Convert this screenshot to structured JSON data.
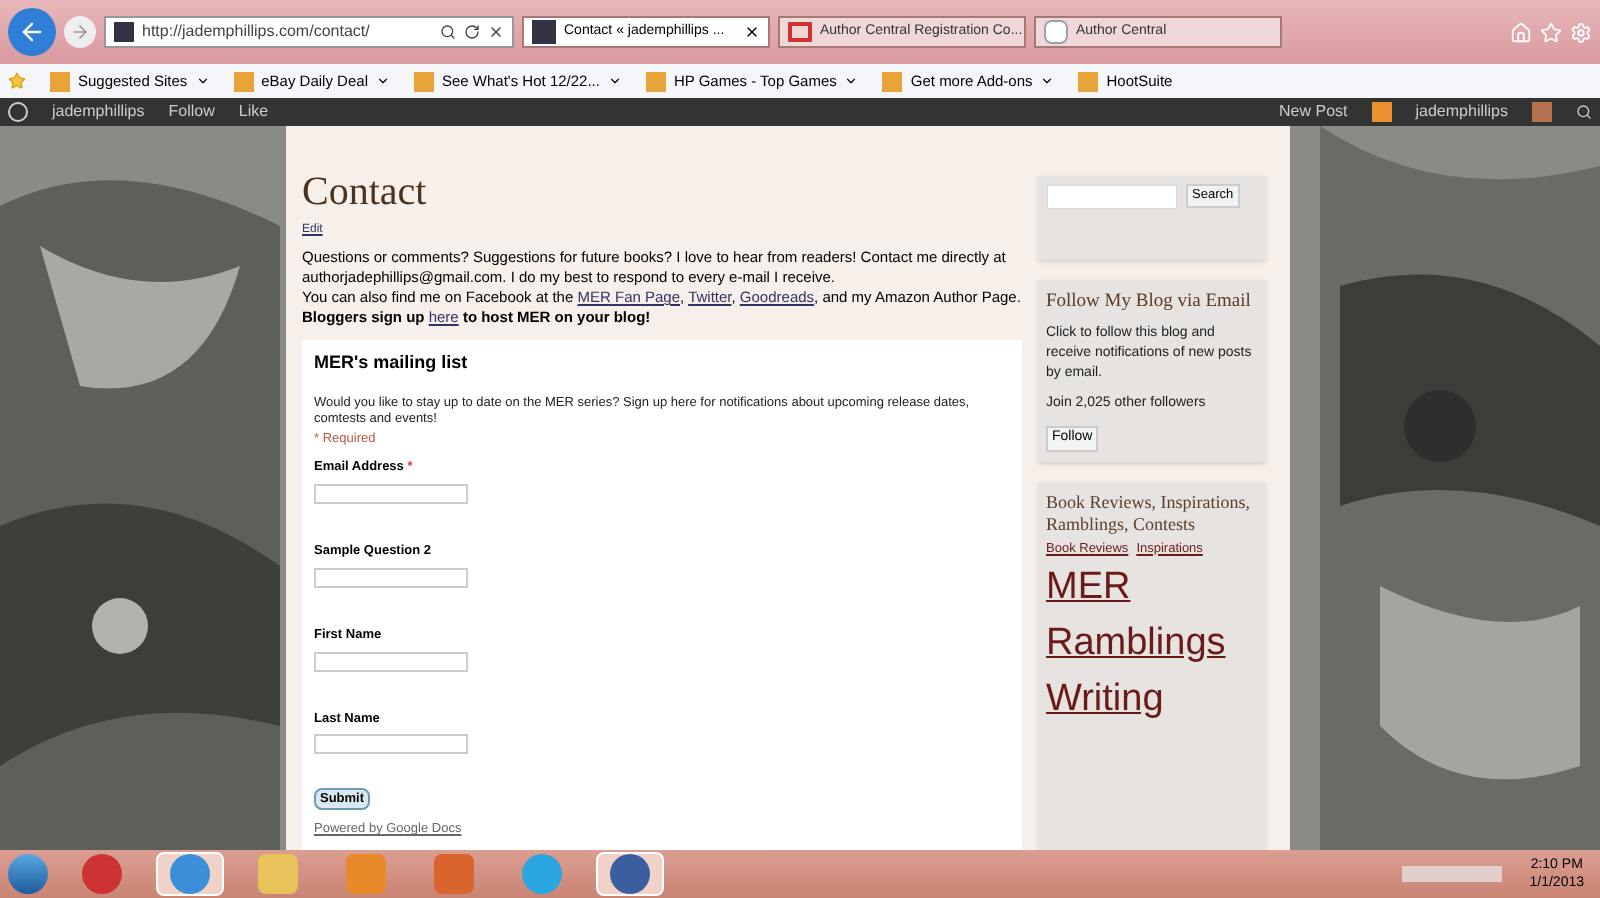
{
  "browser": {
    "address": "http://jademphillips.com/contact/",
    "tabs": [
      {
        "title": "Contact « jademphillips ...",
        "selected": true
      },
      {
        "title": "Author Central Registration Co...",
        "selected": false
      },
      {
        "title": "Author Central",
        "selected": false
      }
    ],
    "favorites": [
      {
        "label": "Suggested Sites",
        "menu": true
      },
      {
        "label": "eBay Daily Deal",
        "menu": true
      },
      {
        "label": "See What's Hot 12/22...",
        "menu": true
      },
      {
        "label": "HP Games - Top Games",
        "menu": true
      },
      {
        "label": "Get more Add-ons",
        "menu": true
      },
      {
        "label": "HootSuite",
        "menu": false
      }
    ]
  },
  "admin_bar": {
    "left": [
      "jademphillips",
      "Follow",
      "Like"
    ],
    "new_post": "New Post",
    "user": "jademphillips"
  },
  "page": {
    "title": "Contact",
    "edit": "Edit",
    "paragraphs": [
      [
        {
          "kind": "text",
          "text": "Questions or comments? Suggestions for future books? I love to hear from readers! Contact me directly at authorjadephillips@gmail.com. I do my best to respond to every e-mail I receive."
        }
      ],
      [
        {
          "kind": "text",
          "text": "You can also find me on Facebook at the "
        },
        {
          "kind": "link",
          "text": "MER Fan Page"
        },
        {
          "kind": "text",
          "text": ", "
        },
        {
          "kind": "link",
          "text": "Twitter"
        },
        {
          "kind": "text",
          "text": ", "
        },
        {
          "kind": "link",
          "text": "Goodreads"
        },
        {
          "kind": "text",
          "text": ", and my Amazon Author Page."
        }
      ],
      [
        {
          "kind": "bold",
          "text": "Bloggers sign up "
        },
        {
          "kind": "link",
          "text": "here"
        },
        {
          "kind": "bold",
          "text": " to host MER on your blog!"
        }
      ]
    ],
    "form": {
      "title": "MER's mailing list",
      "description": "Would you like to stay up to date on the MER series? Sign up here for notifications about upcoming release dates, comtests and events!",
      "required_note": "* Required",
      "fields": [
        {
          "label": "Email Address",
          "required": true
        },
        {
          "label": "Sample Question 2",
          "required": false
        },
        {
          "label": "First Name",
          "required": false
        },
        {
          "label": "Last Name",
          "required": false
        }
      ],
      "required_mark": "*",
      "submit": "Submit",
      "powered_by": "Powered by Google Docs"
    }
  },
  "sidebar": {
    "search_button": "Search",
    "follow": {
      "title": "Follow My Blog via Email",
      "text": "Click to follow this blog and receive notifications of new posts by email.",
      "followers": "Join 2,025 other followers",
      "button": "Follow"
    },
    "tags": {
      "title": "Book Reviews, Inspirations, Ramblings, Contests",
      "small": [
        "Book Reviews",
        "Inspirations"
      ],
      "large": [
        "MER",
        "Ramblings",
        "Writing"
      ]
    }
  },
  "taskbar": {
    "apps": [
      {
        "active": false
      },
      {
        "active": true
      },
      {
        "active": false
      },
      {
        "active": false
      },
      {
        "active": false
      },
      {
        "active": false
      },
      {
        "active": true
      }
    ],
    "time": "2:10 PM",
    "date": "1/1/2013"
  }
}
